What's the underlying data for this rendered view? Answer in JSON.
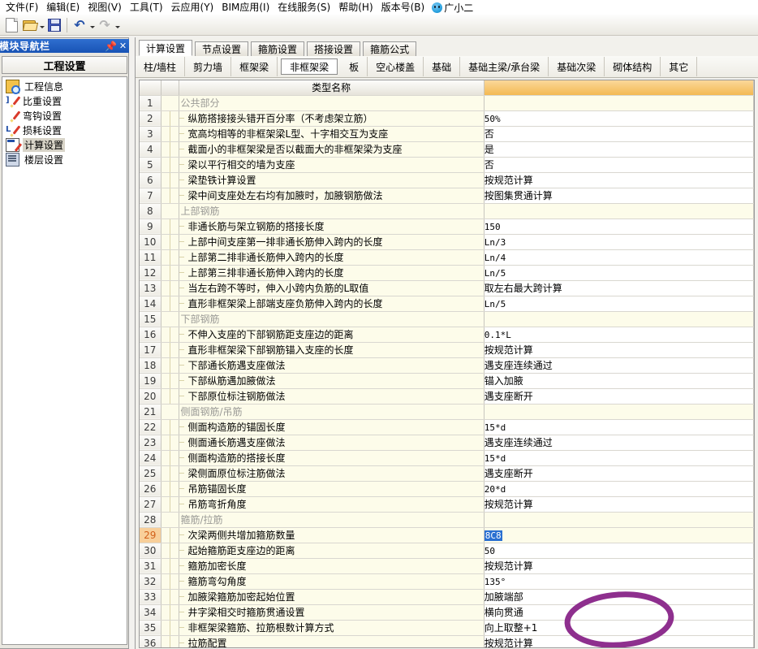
{
  "menubar": {
    "items": [
      {
        "label": "文件(F)"
      },
      {
        "label": "编辑(E)"
      },
      {
        "label": "视图(V)"
      },
      {
        "label": "工具(T)"
      },
      {
        "label": "云应用(Y)"
      },
      {
        "label": "BIM应用(I)"
      },
      {
        "label": "在线服务(S)"
      },
      {
        "label": "帮助(H)"
      },
      {
        "label": "版本号(B)"
      }
    ],
    "user_name": "广小二",
    "user_icon": "qq-penguin-icon"
  },
  "toolbar": {
    "buttons": [
      {
        "name": "new-document-icon",
        "label": "新建"
      },
      {
        "name": "open-folder-icon",
        "label": "打开"
      },
      {
        "name": "save-icon",
        "label": "保存"
      },
      {
        "name": "undo-icon",
        "label": "撤销"
      },
      {
        "name": "redo-icon",
        "label": "恢复"
      }
    ]
  },
  "dock": {
    "title": "模块导航栏",
    "pin_glyph": "⚓",
    "close_glyph": "✕",
    "group_label": "工程设置",
    "items": [
      {
        "label": "工程信息",
        "icon": "project-info-icon",
        "selected": false
      },
      {
        "label": "比重设置",
        "icon": "weight-setting-icon",
        "selected": false
      },
      {
        "label": "弯钩设置",
        "icon": "hook-setting-icon",
        "selected": false
      },
      {
        "label": "损耗设置",
        "icon": "loss-setting-icon",
        "selected": false
      },
      {
        "label": "计算设置",
        "icon": "calc-setting-icon",
        "selected": true
      },
      {
        "label": "楼层设置",
        "icon": "floor-setting-icon",
        "selected": false
      }
    ]
  },
  "tabs": {
    "main": [
      {
        "label": "计算设置",
        "active": true
      },
      {
        "label": "节点设置",
        "active": false
      },
      {
        "label": "箍筋设置",
        "active": false
      },
      {
        "label": "搭接设置",
        "active": false
      },
      {
        "label": "箍筋公式",
        "active": false
      }
    ],
    "sub": [
      {
        "label": "柱/墙柱",
        "active": false
      },
      {
        "label": "剪力墙",
        "active": false
      },
      {
        "label": "框架梁",
        "active": false
      },
      {
        "label": "非框架梁",
        "active": true
      },
      {
        "label": "板",
        "active": false
      },
      {
        "label": "空心楼盖",
        "active": false
      },
      {
        "label": "基础",
        "active": false
      },
      {
        "label": "基础主梁/承台梁",
        "active": false
      },
      {
        "label": "基础次梁",
        "active": false
      },
      {
        "label": "砌体结构",
        "active": false
      },
      {
        "label": "其它",
        "active": false
      }
    ]
  },
  "grid": {
    "headers": {
      "row_num": "",
      "tree": "",
      "name": "类型名称",
      "value": ""
    },
    "rows": [
      {
        "n": "1",
        "type": "group",
        "name": "公共部分",
        "value": ""
      },
      {
        "n": "2",
        "type": "leaf",
        "name": "纵筋搭接接头错开百分率（不考虑架立筋）",
        "value": "50%",
        "mono": true
      },
      {
        "n": "3",
        "type": "leaf",
        "name": "宽高均相等的非框架梁L型、十字相交互为支座",
        "value": "否",
        "mono": false
      },
      {
        "n": "4",
        "type": "leaf",
        "name": "截面小的非框架梁是否以截面大的非框架梁为支座",
        "value": "是",
        "mono": false
      },
      {
        "n": "5",
        "type": "leaf",
        "name": "梁以平行相交的墙为支座",
        "value": "否",
        "mono": false
      },
      {
        "n": "6",
        "type": "leaf",
        "name": "梁垫铁计算设置",
        "value": "按规范计算",
        "mono": false
      },
      {
        "n": "7",
        "type": "leaf",
        "name": "梁中间支座处左右均有加腋时，加腋钢筋做法",
        "value": "按图集贯通计算",
        "mono": false
      },
      {
        "n": "8",
        "type": "group",
        "name": "上部钢筋",
        "value": ""
      },
      {
        "n": "9",
        "type": "leaf",
        "name": "非通长筋与架立钢筋的搭接长度",
        "value": "150",
        "mono": true
      },
      {
        "n": "10",
        "type": "leaf",
        "name": "上部中间支座第一排非通长筋伸入跨内的长度",
        "value": "Ln/3",
        "mono": true
      },
      {
        "n": "11",
        "type": "leaf",
        "name": "上部第二排非通长筋伸入跨内的长度",
        "value": "Ln/4",
        "mono": true
      },
      {
        "n": "12",
        "type": "leaf",
        "name": "上部第三排非通长筋伸入跨内的长度",
        "value": "Ln/5",
        "mono": true
      },
      {
        "n": "13",
        "type": "leaf",
        "name": "当左右跨不等时，伸入小跨内负筋的L取值",
        "value": "取左右最大跨计算",
        "mono": false
      },
      {
        "n": "14",
        "type": "leaf",
        "name": "直形非框架梁上部端支座负筋伸入跨内的长度",
        "value": "Ln/5",
        "mono": true
      },
      {
        "n": "15",
        "type": "group",
        "name": "下部钢筋",
        "value": ""
      },
      {
        "n": "16",
        "type": "leaf",
        "name": "不伸入支座的下部钢筋距支座边的距离",
        "value": "0.1*L",
        "mono": true
      },
      {
        "n": "17",
        "type": "leaf",
        "name": "直形非框架梁下部钢筋锚入支座的长度",
        "value": "按规范计算",
        "mono": false
      },
      {
        "n": "18",
        "type": "leaf",
        "name": "下部通长筋遇支座做法",
        "value": "遇支座连续通过",
        "mono": false
      },
      {
        "n": "19",
        "type": "leaf",
        "name": "下部纵筋遇加腋做法",
        "value": "锚入加腋",
        "mono": false
      },
      {
        "n": "20",
        "type": "leaf",
        "name": "下部原位标注钢筋做法",
        "value": "遇支座断开",
        "mono": false
      },
      {
        "n": "21",
        "type": "group",
        "name": "侧面钢筋/吊筋",
        "value": ""
      },
      {
        "n": "22",
        "type": "leaf",
        "name": "侧面构造筋的锚固长度",
        "value": "15*d",
        "mono": true
      },
      {
        "n": "23",
        "type": "leaf",
        "name": "侧面通长筋遇支座做法",
        "value": "遇支座连续通过",
        "mono": false
      },
      {
        "n": "24",
        "type": "leaf",
        "name": "侧面构造筋的搭接长度",
        "value": "15*d",
        "mono": true
      },
      {
        "n": "25",
        "type": "leaf",
        "name": "梁侧面原位标注筋做法",
        "value": "遇支座断开",
        "mono": false
      },
      {
        "n": "26",
        "type": "leaf",
        "name": "吊筋锚固长度",
        "value": "20*d",
        "mono": true
      },
      {
        "n": "27",
        "type": "leaf",
        "name": "吊筋弯折角度",
        "value": "按规范计算",
        "mono": false
      },
      {
        "n": "28",
        "type": "group",
        "name": "箍筋/拉筋",
        "value": ""
      },
      {
        "n": "29",
        "type": "leaf",
        "name": "次梁两侧共增加箍筋数量",
        "value": "8C8",
        "mono": true,
        "editing": true,
        "current": true
      },
      {
        "n": "30",
        "type": "leaf",
        "name": "起始箍筋距支座边的距离",
        "value": "50",
        "mono": true
      },
      {
        "n": "31",
        "type": "leaf",
        "name": "箍筋加密长度",
        "value": "按规范计算",
        "mono": false
      },
      {
        "n": "32",
        "type": "leaf",
        "name": "箍筋弯勾角度",
        "value": "135°",
        "mono": true
      },
      {
        "n": "33",
        "type": "leaf",
        "name": "加腋梁箍筋加密起始位置",
        "value": "加腋端部",
        "mono": false
      },
      {
        "n": "34",
        "type": "leaf",
        "name": "井字梁相交时箍筋贯通设置",
        "value": "横向贯通",
        "mono": false
      },
      {
        "n": "35",
        "type": "leaf",
        "name": "非框架梁箍筋、拉筋根数计算方式",
        "value": "向上取整+1",
        "mono": false
      },
      {
        "n": "36",
        "type": "leaf",
        "name": "拉筋配置",
        "value": "按规范计算",
        "mono": false
      }
    ]
  },
  "annotation": {
    "shape": "ellipse",
    "color": "#8e2f8e",
    "target": "次梁两侧共增加箍筋数量 value cell"
  },
  "colors": {
    "accent_header": "#f3b953",
    "row_bg": "#fdfcea",
    "current_row_num_bg": "#f8cf9a",
    "selection_blue": "#2a6fd1",
    "titlebar_blue": "#1853b5"
  }
}
